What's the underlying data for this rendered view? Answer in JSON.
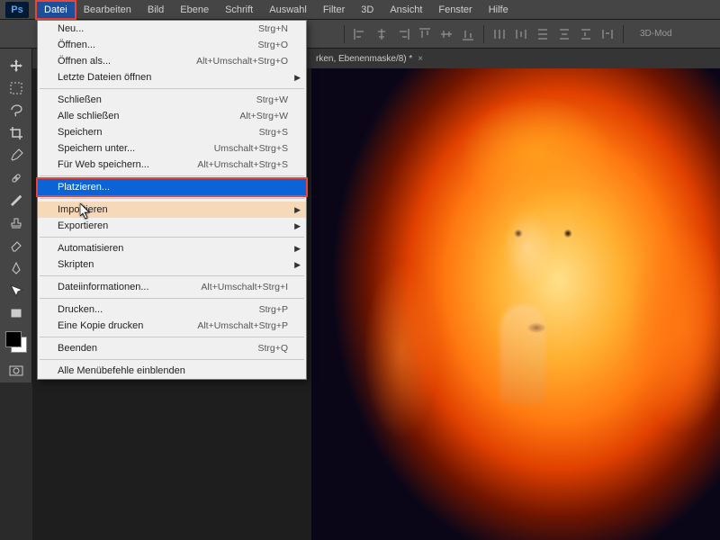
{
  "app": {
    "logo": "Ps"
  },
  "menubar": [
    "Datei",
    "Bearbeiten",
    "Bild",
    "Ebene",
    "Schrift",
    "Auswahl",
    "Filter",
    "3D",
    "Ansicht",
    "Fenster",
    "Hilfe"
  ],
  "active_menu_index": 0,
  "options_bar": {
    "mode_label": "3D-Mod"
  },
  "document_tab": {
    "title": "rken, Ebenenmaske/8) *"
  },
  "dropdown": {
    "groups": [
      [
        {
          "label": "Neu...",
          "shortcut": "Strg+N"
        },
        {
          "label": "Öffnen...",
          "shortcut": "Strg+O"
        },
        {
          "label": "Öffnen als...",
          "shortcut": "Alt+Umschalt+Strg+O"
        },
        {
          "label": "Letzte Dateien öffnen",
          "submenu": true
        }
      ],
      [
        {
          "label": "Schließen",
          "shortcut": "Strg+W"
        },
        {
          "label": "Alle schließen",
          "shortcut": "Alt+Strg+W"
        },
        {
          "label": "Speichern",
          "shortcut": "Strg+S"
        },
        {
          "label": "Speichern unter...",
          "shortcut": "Umschalt+Strg+S"
        },
        {
          "label": "Für Web speichern...",
          "shortcut": "Alt+Umschalt+Strg+S"
        }
      ],
      [
        {
          "label": "Platzieren...",
          "highlighted": true
        }
      ],
      [
        {
          "label": "Importieren",
          "submenu": true,
          "hover2": true
        },
        {
          "label": "Exportieren",
          "submenu": true
        }
      ],
      [
        {
          "label": "Automatisieren",
          "submenu": true
        },
        {
          "label": "Skripten",
          "submenu": true
        }
      ],
      [
        {
          "label": "Dateiinformationen...",
          "shortcut": "Alt+Umschalt+Strg+I"
        }
      ],
      [
        {
          "label": "Drucken...",
          "shortcut": "Strg+P"
        },
        {
          "label": "Eine Kopie drucken",
          "shortcut": "Alt+Umschalt+Strg+P"
        }
      ],
      [
        {
          "label": "Beenden",
          "shortcut": "Strg+Q"
        }
      ],
      [
        {
          "label": "Alle Menübefehle einblenden"
        }
      ]
    ]
  },
  "tools": [
    "move",
    "marquee",
    "lasso",
    "crop",
    "eyedropper",
    "healing",
    "brush",
    "stamp",
    "eraser",
    "pen",
    "path",
    "rectangle"
  ]
}
